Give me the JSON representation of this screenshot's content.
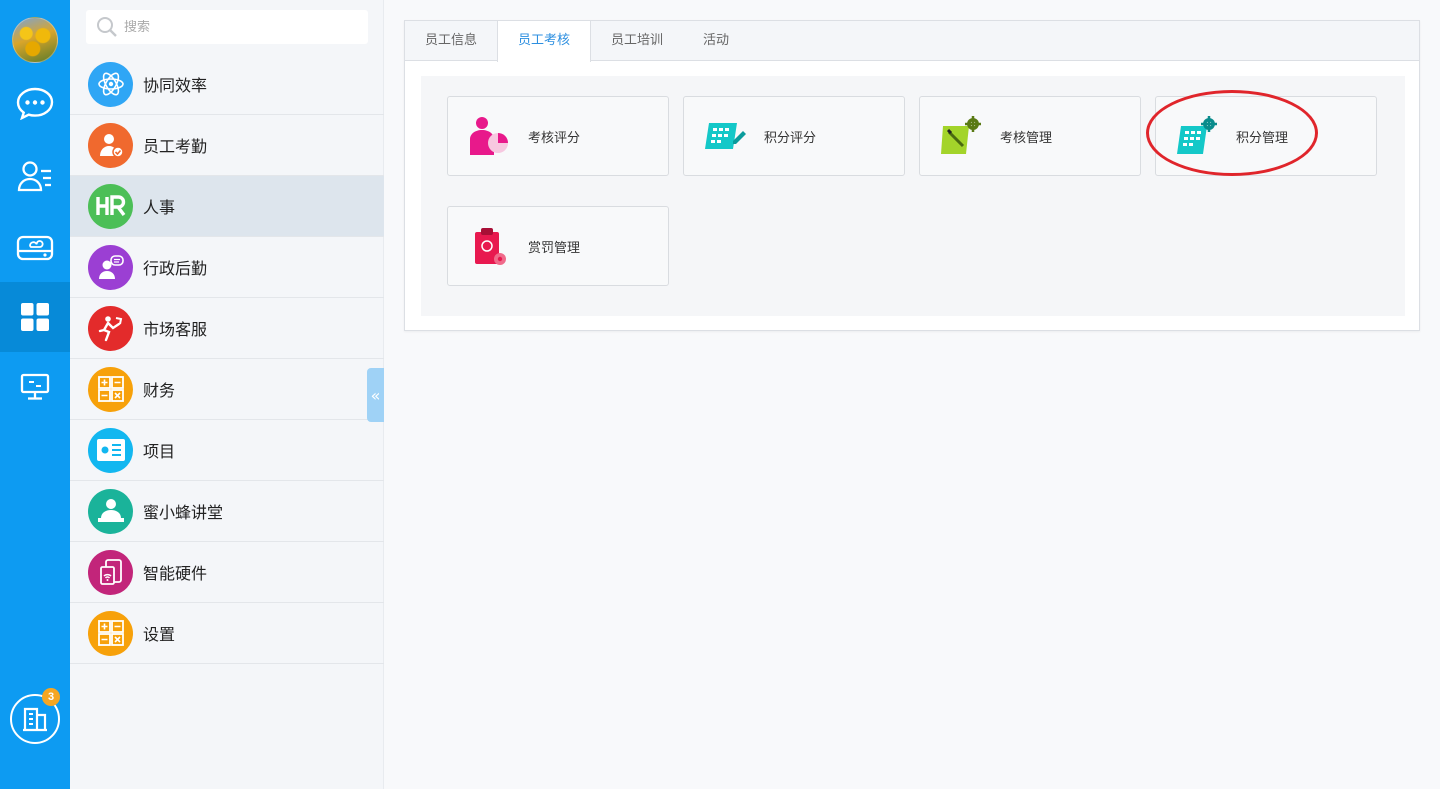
{
  "rail": {
    "items": [
      "chat-icon",
      "contacts-icon",
      "cloud-drive-icon",
      "apps-grid-icon",
      "desktop-icon"
    ],
    "company_badge": "3"
  },
  "sidebar": {
    "search_placeholder": "搜索",
    "items": [
      {
        "label": "协同效率",
        "color": "#2fa6f5"
      },
      {
        "label": "员工考勤",
        "color": "#f0692e"
      },
      {
        "label": "人事",
        "color": "#4cbf57"
      },
      {
        "label": "行政后勤",
        "color": "#9b3fd3"
      },
      {
        "label": "市场客服",
        "color": "#e32b2b"
      },
      {
        "label": "财务",
        "color": "#f7a10a"
      },
      {
        "label": "项目",
        "color": "#12b7f0"
      },
      {
        "label": "蜜小蜂讲堂",
        "color": "#1ab39a"
      },
      {
        "label": "智能硬件",
        "color": "#c2257a"
      },
      {
        "label": "设置",
        "color": "#f7a10a"
      }
    ],
    "collapse_glyph": "«"
  },
  "tabs": [
    "员工信息",
    "员工考核",
    "员工培训",
    "活动"
  ],
  "cards": [
    {
      "label": "考核评分"
    },
    {
      "label": "积分评分"
    },
    {
      "label": "考核管理"
    },
    {
      "label": "积分管理"
    },
    {
      "label": "赏罚管理"
    }
  ]
}
